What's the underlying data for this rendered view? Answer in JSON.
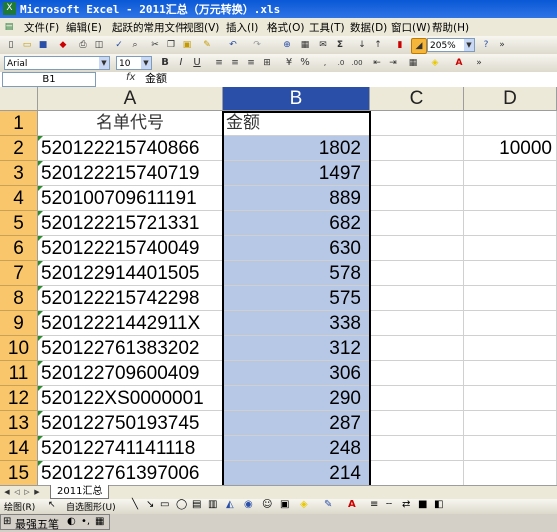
{
  "window": {
    "title": "Microsoft Excel - 2011汇总（万元转换）.xls",
    "logo": "X"
  },
  "menu": [
    "文件(F)",
    "编辑(E)",
    "起跃的常用文件",
    "视图(V)",
    "插入(I)",
    "格式(O)",
    "工具(T)",
    "数据(D)",
    "窗口(W)",
    "帮助(H)"
  ],
  "toolbar": {
    "zoom": "205%"
  },
  "format_toolbar": {
    "font": "Arial",
    "size": "10",
    "bold": "B",
    "italic": "I",
    "underline": "U",
    "percent": "%",
    "currency": "¥"
  },
  "formula_bar": {
    "name_box": "B1",
    "fx": "fx",
    "content": "金额"
  },
  "columns": [
    "A",
    "B",
    "C",
    "D"
  ],
  "header_row": {
    "row": "1",
    "a": "名单代号",
    "b": "金额"
  },
  "rows": [
    {
      "row": "2",
      "a": "520122215740866",
      "b": "1802",
      "d": "10000"
    },
    {
      "row": "3",
      "a": "520122215740719",
      "b": "1497",
      "d": ""
    },
    {
      "row": "4",
      "a": "520100709611191",
      "b": "889",
      "d": ""
    },
    {
      "row": "5",
      "a": "520122215721331",
      "b": "682",
      "d": ""
    },
    {
      "row": "6",
      "a": "520122215740049",
      "b": "630",
      "d": ""
    },
    {
      "row": "7",
      "a": "520122914401505",
      "b": "578",
      "d": ""
    },
    {
      "row": "8",
      "a": "520122215742298",
      "b": "575",
      "d": ""
    },
    {
      "row": "9",
      "a": "52012221442911X",
      "b": "338",
      "d": ""
    },
    {
      "row": "10",
      "a": "520122761383202",
      "b": "312",
      "d": ""
    },
    {
      "row": "11",
      "a": "520122709600409",
      "b": "306",
      "d": ""
    },
    {
      "row": "12",
      "a": "520122XS0000001",
      "b": "290",
      "d": ""
    },
    {
      "row": "13",
      "a": "520122750193745",
      "b": "287",
      "d": ""
    },
    {
      "row": "14",
      "a": "520122741141118",
      "b": "248",
      "d": ""
    },
    {
      "row": "15",
      "a": "520122761397006",
      "b": "214",
      "d": ""
    }
  ],
  "sheet_tab": "2011汇总",
  "draw_toolbar": {
    "draw_label": "绘图(R)",
    "autoshape_label": "自选图形(U)"
  },
  "ime": {
    "label": "最强五笔"
  },
  "colors": {
    "title_bar": "#0a58d6",
    "row_header": "#f9c66b",
    "selection": "#b7c8e6",
    "selected_col_header": "#2a4fa8"
  }
}
